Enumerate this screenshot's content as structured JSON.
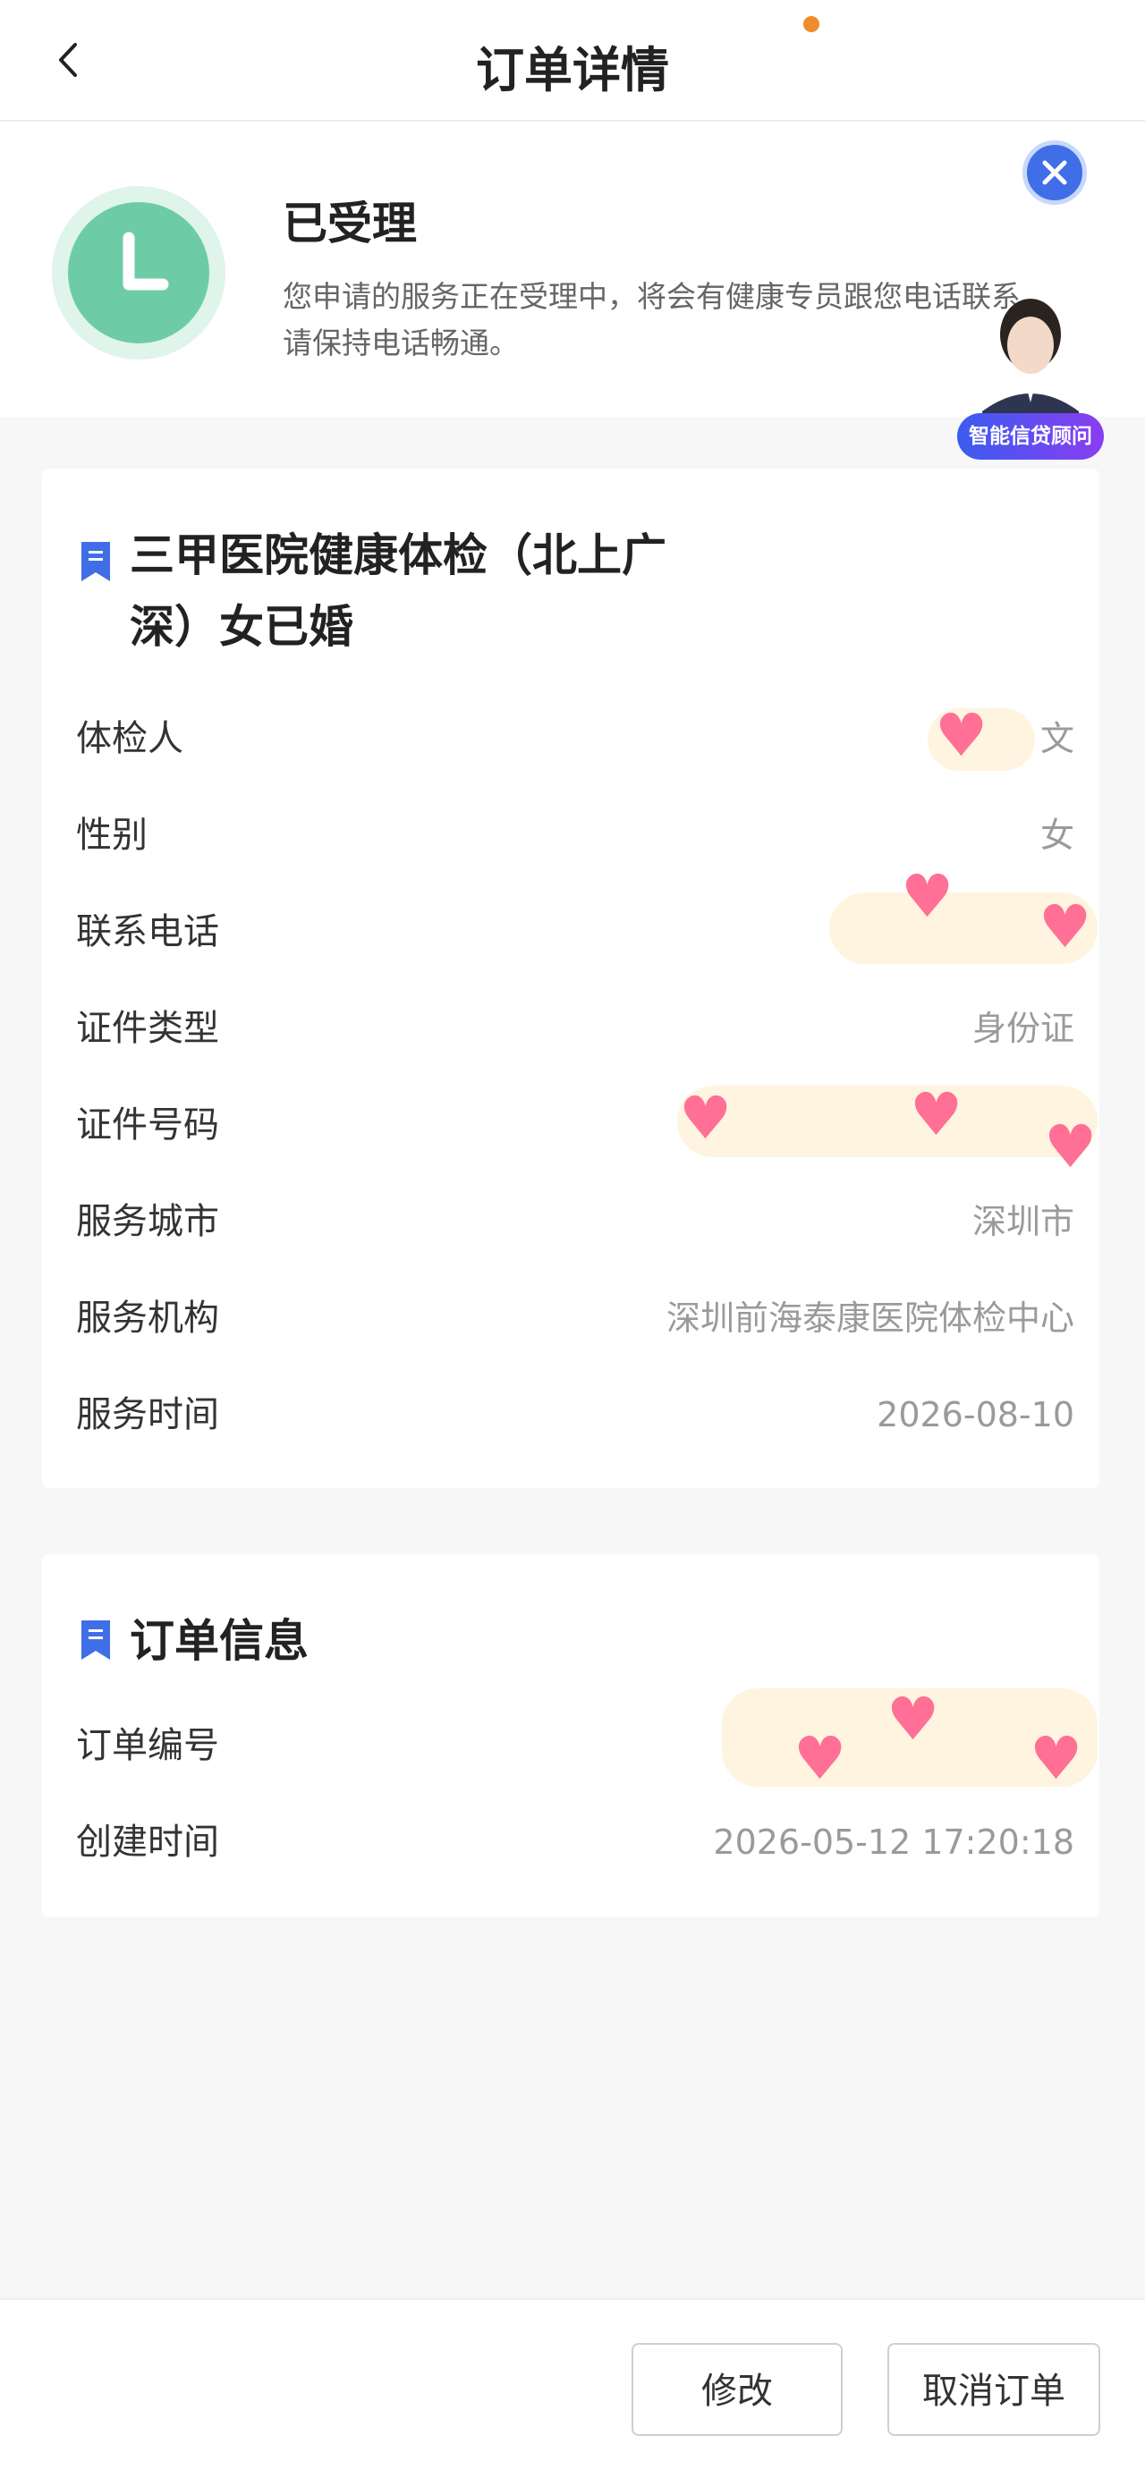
{
  "header": {
    "title": "订单详情"
  },
  "status": {
    "title": "已受理",
    "description": "您申请的服务正在受理中，将会有健康专员跟您电话联系，请保持电话畅通。"
  },
  "advisor": {
    "label": "智能信贷顾问"
  },
  "service_card": {
    "title_line1": "三甲医院健康体检（北上广",
    "title_line2": "深）女已婚",
    "rows": [
      {
        "label": "体检人",
        "value": "文"
      },
      {
        "label": "性别",
        "value": "女"
      },
      {
        "label": "联系电话",
        "value": ""
      },
      {
        "label": "证件类型",
        "value": "身份证"
      },
      {
        "label": "证件号码",
        "value": ""
      },
      {
        "label": "服务城市",
        "value": "深圳市"
      },
      {
        "label": "服务机构",
        "value": "深圳前海泰康医院体检中心"
      },
      {
        "label": "服务时间",
        "value": "2026-08-10"
      }
    ]
  },
  "order_card": {
    "title": "订单信息",
    "rows": [
      {
        "label": "订单编号",
        "value": ""
      },
      {
        "label": "创建时间",
        "value": "2026-05-12 17:20:18"
      }
    ]
  },
  "actions": {
    "modify": "修改",
    "cancel": "取消订单"
  },
  "icons": {
    "back": "chevron-left-icon",
    "clock": "clock-icon",
    "close": "close-icon",
    "bookmark": "bookmark-icon",
    "privacy": "heart-sticker-icon"
  },
  "colors": {
    "accent": "#3f6ee6",
    "status": "#6dcca6",
    "notice_dot": "#f08c2c"
  }
}
